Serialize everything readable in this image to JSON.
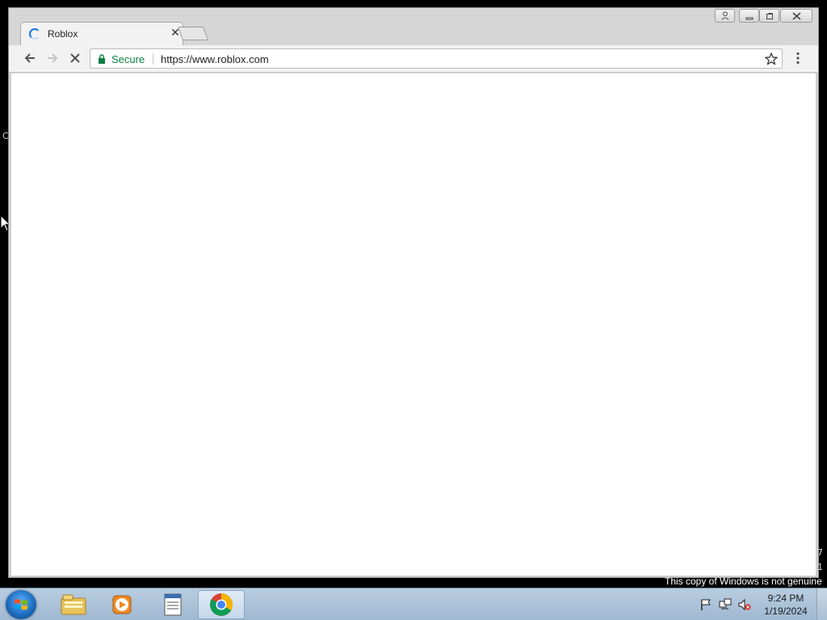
{
  "desktop": {
    "edge_char": "C",
    "side_digits": [
      "7",
      "1"
    ],
    "watermark": "This copy of Windows is not genuine"
  },
  "browser": {
    "tab": {
      "title": "Roblox",
      "close_glyph": "✕"
    },
    "window_controls": {
      "minimize": "—",
      "maximize": "□",
      "close": "✕"
    },
    "address_bar": {
      "security_label": "Secure",
      "url": "https://www.roblox.com"
    },
    "page_state": "loading"
  },
  "taskbar": {
    "pinned": [
      "windows-explorer-icon",
      "media-player-icon",
      "notepad-icon",
      "chrome-icon"
    ],
    "clock": {
      "time": "9:24 PM",
      "date": "1/19/2024"
    }
  },
  "colors": {
    "secure_green": "#0b8043",
    "spinner_blue": "#1a73e8",
    "taskbar": "#a9c1d8"
  }
}
